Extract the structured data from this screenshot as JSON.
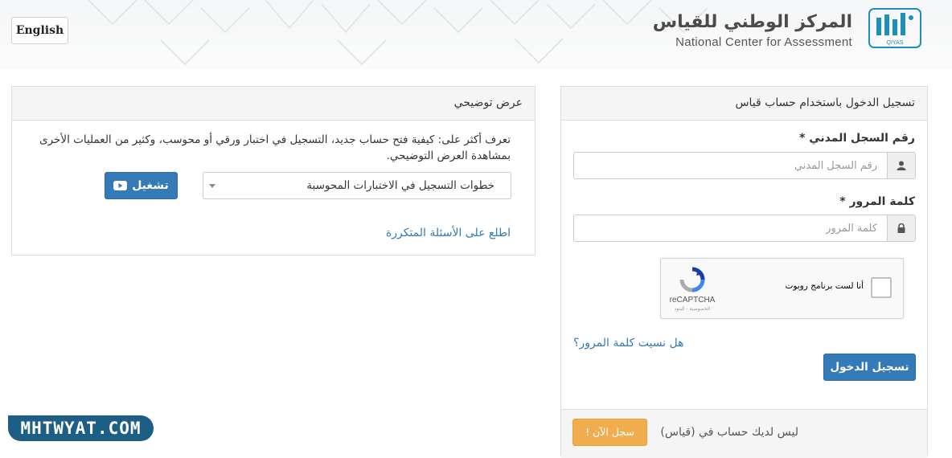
{
  "header": {
    "language_button": "English",
    "brand_ar": "المركز الوطني للقياس",
    "brand_en": "National Center for Assessment",
    "logo_text": "QIYAS"
  },
  "login": {
    "title": "تسجيل الدخول باستخدام حساب قياس",
    "id_label": "رقم السجل المدني *",
    "id_placeholder": "رقم السجل المدني",
    "password_label": "كلمة المرور *",
    "password_placeholder": "كلمة المرور",
    "captcha": {
      "label": "أنا لست برنامج روبوت",
      "brand": "reCAPTCHA",
      "links": "الخصوصية - البنود"
    },
    "forgot_password": "هل نسيت كلمة المرور؟",
    "submit": "تسجيل الدخول",
    "no_account": "ليس لديك حساب في (قياس)",
    "register": "سجل الآن !"
  },
  "demo": {
    "title": "عرض توضيحي",
    "description": "تعرف أكثر على: كيفية فتح حساب جديد، التسجيل في اختبار ورقي أو محوسب، وكثير من العمليات الأخرى بمشاهدة العرض التوضيحي.",
    "selected_option": "خطوات التسجيل في الاختبارات المحوسبة",
    "play_button": "تشغيل",
    "faq_link": "اطلع على الأسئلة المتكررة"
  },
  "watermark": "MHTWYAT.COM",
  "colors": {
    "primary": "#337ab7",
    "warning": "#f0ad4e",
    "brand_teal": "#1f8fb5",
    "watermark": "#1d5e86"
  }
}
